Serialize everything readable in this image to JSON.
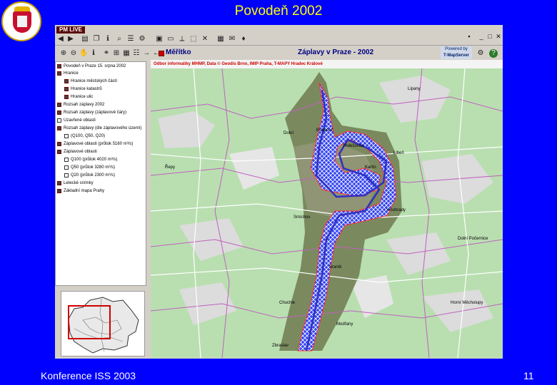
{
  "slide": {
    "title": "Povodeň 2002",
    "footer_left": "Konference ISS 2003",
    "page_number": "11"
  },
  "app": {
    "logo": "PM LIVE",
    "toolbar": {
      "meritko_label": "Měřítko",
      "map_title": "Záplavy v Praze - 2002",
      "brand_line1": "Powered by",
      "brand_line2": "T-MapServer",
      "help_label": "?"
    }
  },
  "layers": {
    "root": "Povodeň v Praze 15. srpna 2002",
    "items": [
      {
        "label": "Hranice",
        "indent": false,
        "checked": true
      },
      {
        "label": "Hranice městských částí",
        "indent": true,
        "checked": true
      },
      {
        "label": "Hranice katastrů",
        "indent": true,
        "checked": true
      },
      {
        "label": "Hranice ulic",
        "indent": true,
        "checked": true
      },
      {
        "label": "Rozsah záplavy 2002",
        "indent": false,
        "checked": true
      },
      {
        "label": "Rozsah záplavy (záplavové čáry)",
        "indent": false,
        "checked": true
      },
      {
        "label": "Uzavřené oblasti",
        "indent": false,
        "checked": false
      },
      {
        "label": "Rozsah záplavy (dle záplavového území)",
        "indent": false,
        "checked": true
      },
      {
        "label": "(Q100, Q50, Q20)",
        "indent": true,
        "checked": false
      },
      {
        "label": "Záplavové oblasti (průtok 5160 m³/s)",
        "indent": false,
        "checked": true
      },
      {
        "label": "Záplavové oblasti",
        "indent": false,
        "checked": true
      },
      {
        "label": "Q100 (průtok 4020 m³/s)",
        "indent": true,
        "checked": false
      },
      {
        "label": "Q50 (průtok 3280 m³/s)",
        "indent": true,
        "checked": false
      },
      {
        "label": "Q20 (průtok 2300 m³/s)",
        "indent": true,
        "checked": false
      },
      {
        "label": "Letecké snímky",
        "indent": false,
        "checked": true
      },
      {
        "label": "Základní mapa Prahy",
        "indent": false,
        "checked": true
      }
    ]
  },
  "map": {
    "header": "Odbor informatiky MHMP, Data © Geodis Brno, IMIP Praha, T-MAPY Hradec Králové",
    "labels": [
      "Dolní",
      "Bubeneč",
      "Karlín",
      "Libeň",
      "Holešovice",
      "Smíchov",
      "Vinohrady",
      "Braník",
      "Zbraslav",
      "Chuchle",
      "Řepy",
      "Modřany",
      "Dolní Počernice",
      "Horní Měcholupy",
      "Lipany"
    ]
  }
}
